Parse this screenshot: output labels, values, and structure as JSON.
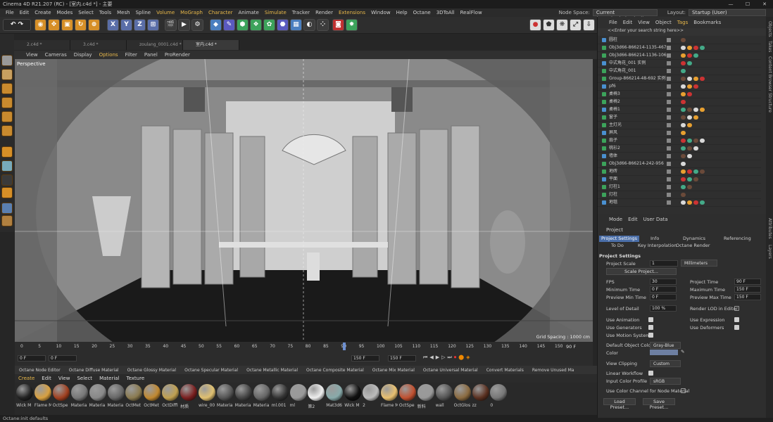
{
  "title": "Cinema 4D R21.207 (RC) - [室内.c4d *] - 主要",
  "window_buttons": [
    "—",
    "☐",
    "✕"
  ],
  "menu": [
    "File",
    "Edit",
    "Create",
    "Modes",
    "Select",
    "Tools",
    "Mesh",
    "Spline",
    "Volume",
    "MoGraph",
    "Character",
    "Animate",
    "Simulate",
    "Tracker",
    "Render",
    "Extensions",
    "Window",
    "Help",
    "Octane",
    "3DToAll",
    "RealFlow"
  ],
  "node_space": {
    "label": "Node Space:",
    "value": "Current (Standard/Physical)"
  },
  "layout": {
    "label": "Layout:",
    "value": "Startup (User)"
  },
  "axis_buttons": [
    "X",
    "Y",
    "Z"
  ],
  "doc_tabs": [
    "2.c4d *",
    "3.c4d *",
    "zoulang_0001.c4d *",
    "室内.c4d *"
  ],
  "viewport_menu": [
    "View",
    "Cameras",
    "Display",
    "Options",
    "Filter",
    "Panel",
    "ProRender"
  ],
  "viewport_label": "Perspective",
  "grid_spacing": "Grid Spacing : 1000 cm",
  "timeline": {
    "ticks": [
      "0",
      "5",
      "10",
      "15",
      "20",
      "25",
      "30",
      "35",
      "40",
      "45",
      "50",
      "55",
      "60",
      "65",
      "70",
      "75",
      "80",
      "85",
      "90",
      "95",
      "100",
      "105",
      "110",
      "115",
      "120",
      "125",
      "130",
      "135",
      "140",
      "145",
      "150"
    ],
    "end_frame": "90 F",
    "field_start": "0 F",
    "field_cur": "0 F",
    "field_end": "150 F",
    "field_max": "150 F"
  },
  "mat_toolbar": [
    "Octane Node Editor",
    "Octane Diffuse Material",
    "Octane Glossy Material",
    "Octane Specular Material",
    "Octane Metallic Material",
    "Octane Composite Material",
    "Octane Mix Material",
    "Octane Universal Material",
    "Convert Materials",
    "Remove Unused Ma"
  ],
  "mat_menu": [
    "Create",
    "Edit",
    "View",
    "Select",
    "Material",
    "Texture"
  ],
  "materials": [
    "Wick M",
    "Flame M",
    "OctSpe",
    "Materia",
    "Materia",
    "Materia",
    "OctMet",
    "OctMet",
    "OctDiffi",
    "材质",
    "wire_00",
    "Materia",
    "Materia",
    "Materia",
    "ml.001",
    "ml",
    "第2",
    "Mat3d6",
    "Wick M",
    "2",
    "Flame M",
    "OctSpe",
    "新料",
    "wall",
    "OctGlos",
    "zz",
    "0"
  ],
  "status": "Octane:init defaults",
  "obj_menu": [
    "File",
    "Edit",
    "View",
    "Object",
    "Tags",
    "Bookmarks"
  ],
  "obj_search": "<<Enter your search string here>>",
  "objects": [
    "圆柱",
    "Obj3d66-866214-1135-467",
    "Obj3d66-866214-1136-106",
    "中式角花_001 实例",
    "中式角花_001",
    "Group-866214-48-692 实例",
    "pf6",
    "桌椅3",
    "桌椅2",
    "桌椅1",
    "窗子",
    "主灯光",
    "屏风",
    "扇子",
    "桃衫2",
    "墙体",
    "Obj3d66-866214-242-956",
    "地砖",
    "平面",
    "灯柱1",
    "灯柱",
    "地毯"
  ],
  "attr_menu": [
    "Mode",
    "Edit",
    "User Data"
  ],
  "attr_object": "Project",
  "attr_tabs": [
    "Project Settings",
    "Info",
    "Dynamics",
    "Referencing",
    "To Do",
    "Key Interpolation",
    "Octane Render"
  ],
  "section": "Project Settings",
  "project_scale": {
    "label": "Project Scale",
    "value": "1",
    "unit": "Millimeters"
  },
  "scale_btn": "Scale Project...",
  "fps": {
    "label": "FPS",
    "value": "30"
  },
  "project_time": {
    "label": "Project Time",
    "value": "90 F"
  },
  "min_time": {
    "label": "Minimum Time",
    "value": "0 F"
  },
  "max_time": {
    "label": "Maximum Time",
    "value": "150 F"
  },
  "prev_min": {
    "label": "Preview Min Time",
    "value": "0 F"
  },
  "prev_max": {
    "label": "Preview Max Time",
    "value": "150 F"
  },
  "lod": {
    "label": "Level of Detail",
    "value": "100 %"
  },
  "render_lod": "Render LOD in Editor",
  "use_anim": "Use Animation",
  "use_expr": "Use Expression",
  "use_gen": "Use Generators",
  "use_def": "Use Deformers",
  "use_motion": "Use Motion System",
  "def_color": {
    "label": "Default Object Color",
    "value": "Gray-Blue"
  },
  "color": "Color",
  "view_clip": {
    "label": "View Clipping",
    "value": "Custom"
  },
  "linear": "Linear Workflow",
  "input_profile": {
    "label": "Input Color Profile",
    "value": "sRGB"
  },
  "node_color": "Use Color Channel for Node Material",
  "load_btn": "Load Preset...",
  "save_btn": "Save Preset...",
  "right_tabs": [
    "Objects",
    "Takes",
    "Content Browser",
    "Structure",
    "Attributes",
    "Layers"
  ]
}
